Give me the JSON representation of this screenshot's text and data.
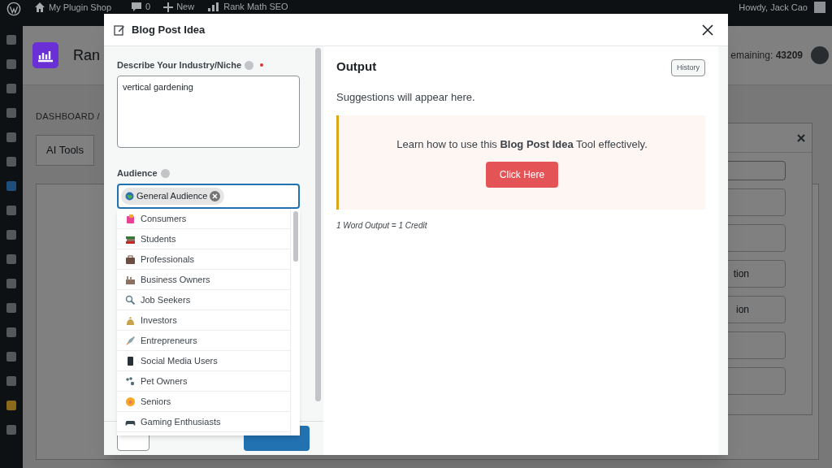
{
  "admin_bar": {
    "site": "My Plugin Shop",
    "comments": "0",
    "new": "New",
    "plugin": "Rank Math SEO",
    "greeting": "Howdy, Jack Cao"
  },
  "page": {
    "title": "Ran",
    "breadcrumb": "DASHBOARD /",
    "tabs": [
      {
        "label": "AI Tools",
        "selected": true
      }
    ],
    "credits_label": "emaining:",
    "credits": "43209",
    "side_panel": {
      "buttons": [
        {
          "label": "tion"
        },
        {
          "label": "ion"
        }
      ]
    }
  },
  "modal": {
    "title": "Blog Post Idea",
    "niche": {
      "label": "Describe Your Industry/Niche",
      "required": true,
      "value": "vertical gardening"
    },
    "audience": {
      "label": "Audience",
      "chips": [
        {
          "label": "General Audience"
        }
      ],
      "options": [
        {
          "label": "Consumers"
        },
        {
          "label": "Students"
        },
        {
          "label": "Professionals"
        },
        {
          "label": "Business Owners"
        },
        {
          "label": "Job Seekers"
        },
        {
          "label": "Investors"
        },
        {
          "label": "Entrepreneurs"
        },
        {
          "label": "Social Media Users"
        },
        {
          "label": "Pet Owners"
        },
        {
          "label": "Seniors"
        },
        {
          "label": "Gaming Enthusiasts"
        }
      ]
    },
    "output": {
      "heading": "Output",
      "history": "History",
      "empty": "Suggestions will appear here.",
      "notice": "Learn how to use this **Blog Post Idea** Tool effectively.",
      "notice_button": "Click Here",
      "cost": "1 Word Output = 1 Credit"
    }
  }
}
